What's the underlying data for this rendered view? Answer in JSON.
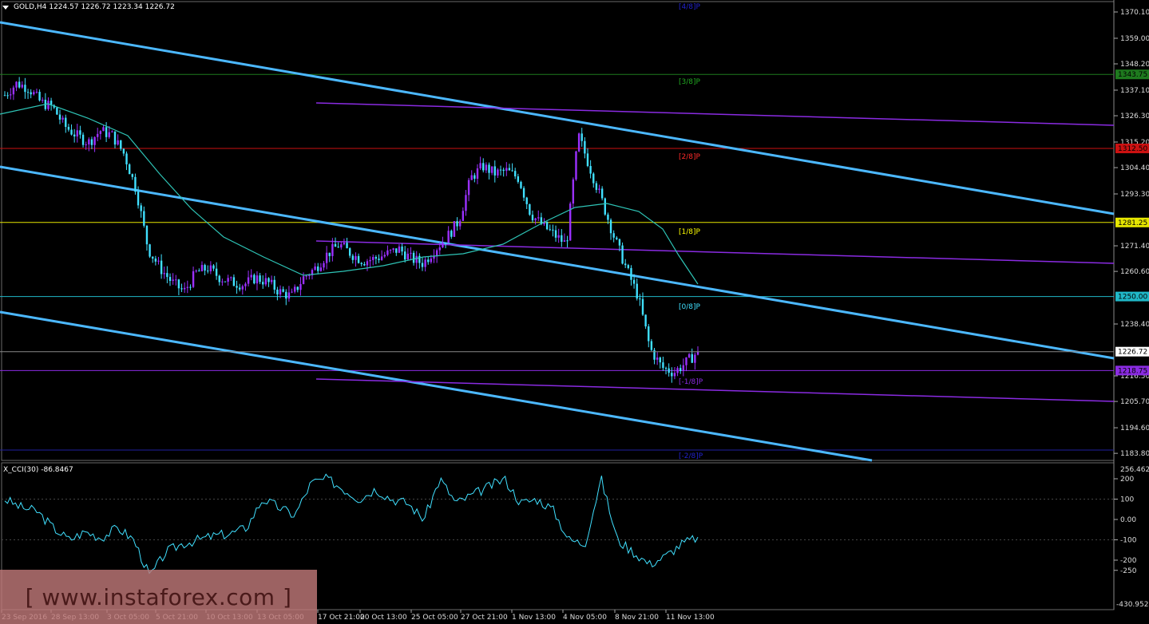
{
  "header": {
    "symbol": "GOLD,H4",
    "ohlc": "1224.57 1226.72 1223.34 1226.72"
  },
  "cci": {
    "label": "X_CCI(30) -86.8467",
    "scale_top": "256.462",
    "scale_bottom": "-430.9526",
    "ticks": [
      "200",
      "100",
      "0.00",
      "-100",
      "-200",
      "-250"
    ]
  },
  "price_axis": {
    "ticks": [
      "1370.10",
      "1359.00",
      "1348.20",
      "1337.10",
      "1326.30",
      "1315.20",
      "1304.40",
      "1293.30",
      "1271.40",
      "1260.60",
      "1238.40",
      "1216.50",
      "1205.70",
      "1194.60",
      "1183.80"
    ],
    "current_price": "1226.72",
    "level_tags": [
      {
        "value": "1343.75",
        "bg": "#1e7a1e"
      },
      {
        "value": "1312.50",
        "bg": "#cc1111"
      },
      {
        "value": "1281.25",
        "bg": "#e6e600"
      },
      {
        "value": "1250.00",
        "bg": "#20b8c8"
      },
      {
        "value": "1218.75",
        "bg": "#8a2be2"
      }
    ]
  },
  "murrey_labels": [
    {
      "text": "[4/8]P",
      "color": "#2222cc"
    },
    {
      "text": "[3/8]P",
      "color": "#22aa22"
    },
    {
      "text": "[2/8]P",
      "color": "#ff2a2a"
    },
    {
      "text": "[1/8]P",
      "color": "#ffff00"
    },
    {
      "text": "[0/8]P",
      "color": "#40e0ff"
    },
    {
      "text": "[-1/8]P",
      "color": "#8a2be2"
    },
    {
      "text": "[-2/8]P",
      "color": "#2222cc"
    }
  ],
  "time_axis": [
    "23 Sep 2016",
    "28 Sep 13:00",
    "3 Oct 05:00",
    "5 Oct 21:00",
    "10 Oct 13:00",
    "13 Oct 05:00",
    "17 Oct 21:00",
    "20 Oct 13:00",
    "25 Oct 05:00",
    "27 Oct 21:00",
    "1 Nov 13:00",
    "4 Nov 05:00",
    "8 Nov 21:00",
    "11 Nov 13:00"
  ],
  "watermark": "[ www.instaforex.com ]",
  "colors": {
    "up_candle": "#9b30ff",
    "down_candle": "#40e0ff",
    "channel": "#4cb8ff",
    "ma": "#2ec4b6",
    "cci_line": "#40e0ff",
    "purple_line": "#8a2be2"
  },
  "chart_data": {
    "type": "candlestick",
    "symbol": "GOLD",
    "timeframe": "H4",
    "ylim": [
      1183.8,
      1370.1
    ],
    "close_path": [
      1335,
      1340,
      1338,
      1332,
      1330,
      1322,
      1318,
      1315,
      1320,
      1318,
      1310,
      1295,
      1270,
      1262,
      1256,
      1252,
      1260,
      1262,
      1258,
      1256,
      1255,
      1258,
      1256,
      1252,
      1250,
      1258,
      1262,
      1268,
      1272,
      1268,
      1265,
      1266,
      1268,
      1270,
      1266,
      1264,
      1270,
      1275,
      1282,
      1300,
      1305,
      1302,
      1303,
      1300,
      1285,
      1280,
      1276,
      1272,
      1318,
      1304,
      1290,
      1275,
      1262,
      1250,
      1228,
      1220,
      1218,
      1222,
      1226.72
    ],
    "cci_path": [
      100,
      60,
      40,
      -40,
      -100,
      -60,
      -90,
      -40,
      -100,
      -280,
      -160,
      -120,
      -100,
      -80,
      -70,
      -40,
      100,
      60,
      20,
      180,
      200,
      150,
      100,
      150,
      100,
      80,
      0,
      200,
      80,
      120,
      160,
      200,
      80,
      100,
      50,
      -100,
      -120,
      200,
      -100,
      -160,
      -220,
      -180,
      -120,
      -86.85
    ]
  }
}
